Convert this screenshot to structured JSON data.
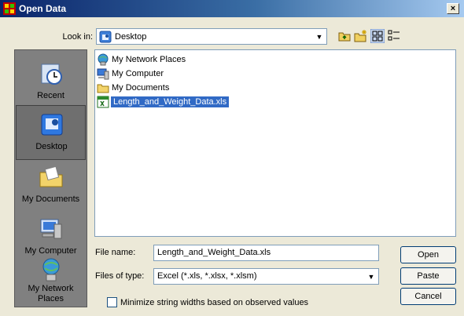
{
  "window": {
    "title": "Open Data",
    "close_glyph": "×"
  },
  "lookin": {
    "label": "Look in:",
    "value": "Desktop",
    "icon": "desktop-icon"
  },
  "toolbar": {
    "icons": [
      "up-folder-icon",
      "new-folder-icon",
      "list-view-icon",
      "details-view-icon"
    ]
  },
  "places": [
    {
      "label": "Recent",
      "icon": "recent-icon",
      "selected": false
    },
    {
      "label": "Desktop",
      "icon": "desktop-icon",
      "selected": true
    },
    {
      "label": "My Documents",
      "icon": "my-documents-icon",
      "selected": false
    },
    {
      "label": "My Computer",
      "icon": "my-computer-icon",
      "selected": false
    },
    {
      "label": "My Network\nPlaces",
      "icon": "network-places-icon",
      "selected": false
    }
  ],
  "files": [
    {
      "name": "My Network Places",
      "icon": "network-icon"
    },
    {
      "name": "My Computer",
      "icon": "computer-icon"
    },
    {
      "name": "My Documents",
      "icon": "folder-icon"
    },
    {
      "name": "Length_and_Weight_Data.xls",
      "icon": "excel-file-icon",
      "selected": true
    }
  ],
  "filename": {
    "label": "File name:",
    "value": "Length_and_Weight_Data.xls"
  },
  "filetype": {
    "label": "Files of type:",
    "value": "Excel (*.xls, *.xlsx, *.xlsm)"
  },
  "buttons": {
    "open": "Open",
    "paste": "Paste",
    "cancel": "Cancel"
  },
  "option": {
    "label": "Minimize string widths based on observed values",
    "checked": false
  },
  "colors": {
    "title_start": "#0a246a",
    "title_end": "#a6caf0",
    "selection": "#316ac5",
    "places_bg": "#808080"
  }
}
